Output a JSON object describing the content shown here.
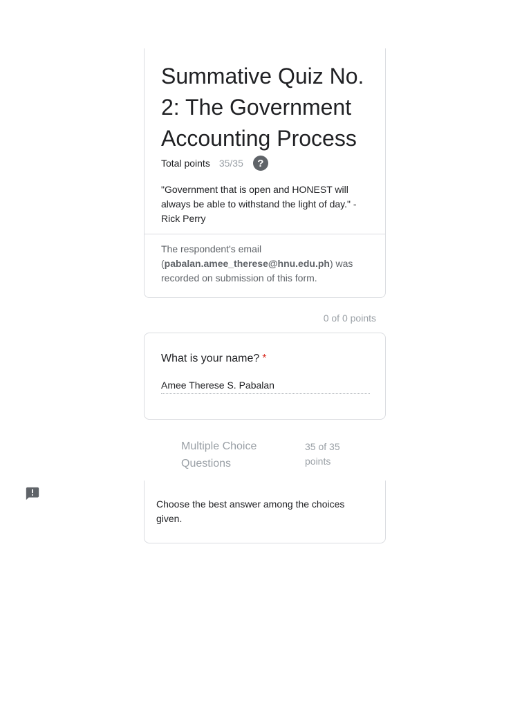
{
  "form": {
    "title": "Summative Quiz No. 2: The Government Accounting Process",
    "total_points_label": "Total points",
    "total_points_value": "35/35",
    "help_icon": "help-circle-icon",
    "description": "\"Government that is open and HONEST will always be able to withstand the light of day.\" -Rick Perry",
    "email_notice": {
      "prefix": "The respondent's email (",
      "email": "pabalan.amee_therese@hnu.edu.ph",
      "suffix": ") was recorded on submission of this form."
    }
  },
  "section_one": {
    "points": "0 of 0 points",
    "question": {
      "title": "What is your name?",
      "required_mark": "*",
      "answer": "Amee Therese S. Pabalan"
    }
  },
  "section_two": {
    "title": "Multiple Choice Questions",
    "score": "35 of 35 points",
    "description": "Choose the best answer among the choices given."
  },
  "feedback_button": {
    "icon": "report-feedback-icon"
  },
  "colors": {
    "border": "#dadce0",
    "muted_text": "#9aa0a6",
    "required": "#d93025",
    "icon": "#5f6368"
  }
}
